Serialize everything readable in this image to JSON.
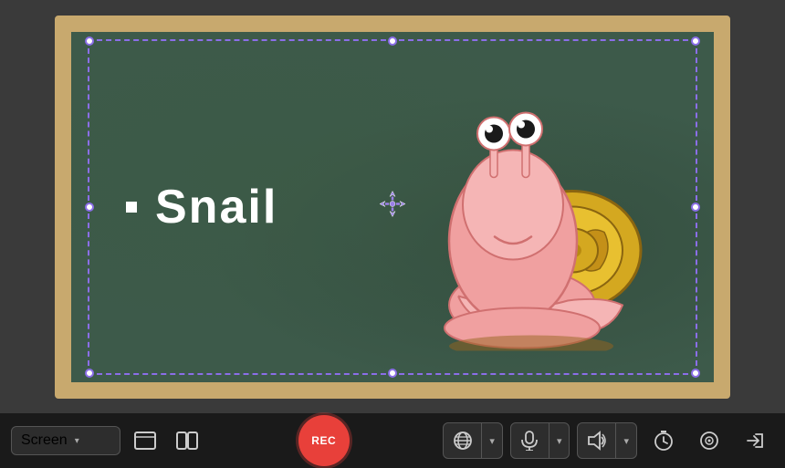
{
  "canvas": {
    "background_color": "#3a3a3a"
  },
  "chalkboard": {
    "text": "Snail",
    "border_color": "#c8a96e",
    "bg_color": "#3d5a4a"
  },
  "selection": {
    "border_color": "#8b6ee8"
  },
  "move_cursor": "⊕",
  "toolbar": {
    "screen_label": "Screen",
    "screen_chevron": "▾",
    "rec_label": "REC",
    "layout_icons": [
      "▭",
      "▬"
    ],
    "globe_icon": "🌐",
    "mic_icon": "🎤",
    "speaker_icon": "🔊",
    "clock_icon": "⏰",
    "camera_icon": "⊙",
    "exit_icon": "→|"
  }
}
